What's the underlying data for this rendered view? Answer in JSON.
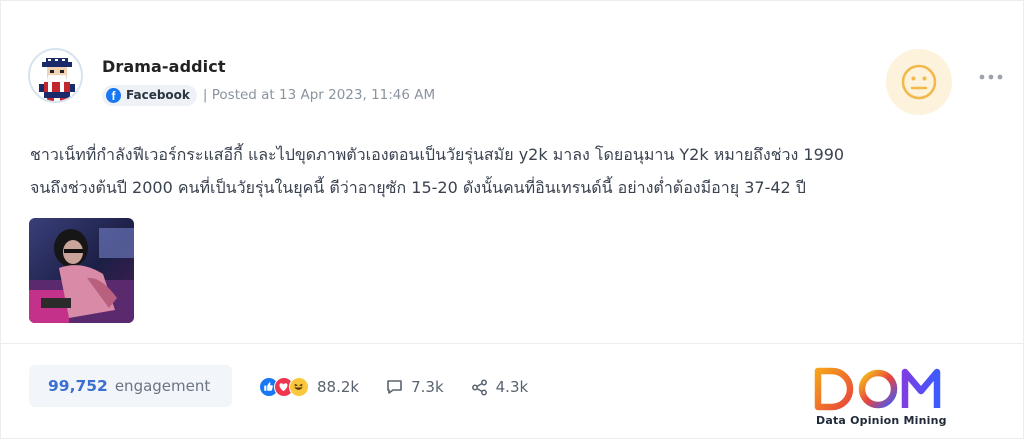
{
  "post": {
    "author": "Drama-addict",
    "source_label": "Facebook",
    "posted": "| Posted at 13 Apr 2023, 11:46 AM",
    "body_line1": "ชาวเน็ทที่กำลังฟีเวอร์กระแสอีกี้ และไปขุดภาพตัวเองตอนเป็นวัยรุ่นสมัย y2k มาลง โดยอนุมาน Y2k หมายถึงช่วง 1990",
    "body_line2": "จนถึงช่วงต้นปี 2000 คนที่เป็นวัยรุ่นในยุคนี้ ตีว่าอายุซัก 15-20 ดังนั้นคนที่อินเทรนด์นี้ อย่างต่ำต้องมีอายุ 37-42 ปี",
    "sentiment_icon": "neutral-face-icon",
    "sentiment_color": "#f2b84b"
  },
  "footer": {
    "engagement_value": "99,752",
    "engagement_label": "engagement",
    "reactions_count": "88.2k",
    "comments_count": "7.3k",
    "shares_count": "4.3k",
    "reaction_icons": [
      "like-icon",
      "love-icon",
      "haha-icon"
    ]
  },
  "brand": {
    "logo_text": "DOM",
    "tagline": "Data Opinion Mining",
    "accent_colors": [
      "#f6a21a",
      "#e8453c",
      "#3d5afe"
    ]
  }
}
